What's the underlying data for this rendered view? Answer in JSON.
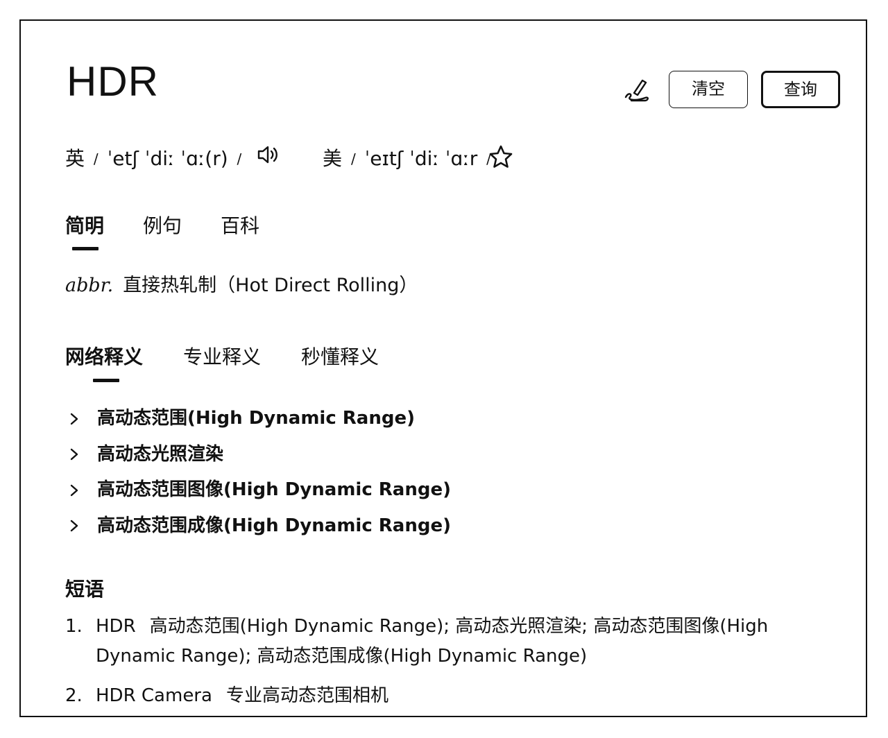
{
  "entry": {
    "word": "HDR"
  },
  "toolbar": {
    "handwrite_icon": "handwriting-pen-icon",
    "clear_label": "清空",
    "query_label": "查询"
  },
  "pronunciation": {
    "uk": {
      "label": "英",
      "ipa": "ˈetʃ ˈdiː ˈɑː(r)"
    },
    "us": {
      "label": "美",
      "ipa": "ˈeɪtʃ ˈdiː ˈɑːr"
    },
    "slash": "/",
    "speaker_icon": "speaker-icon",
    "favorite_icon": "star-icon"
  },
  "tabs_primary": {
    "items": [
      "简明",
      "例句",
      "百科"
    ],
    "active": 0
  },
  "brief": {
    "pos": "abbr.",
    "definition": "直接热轧制（Hot Direct Rolling）"
  },
  "tabs_secondary": {
    "items": [
      "网络释义",
      "专业释义",
      "秒懂释义"
    ],
    "active": 0
  },
  "web_definitions": [
    "高动态范围(High Dynamic Range)",
    "高动态光照渲染",
    "高动态范围图像(High Dynamic Range)",
    "高动态范围成像(High Dynamic Range)"
  ],
  "phrases": {
    "title": "短语",
    "items": [
      {
        "num": "1.",
        "en": "HDR",
        "zh": "高动态范围(High Dynamic Range); 高动态光照渲染; 高动态范围图像(High Dynamic Range); 高动态范围成像(High Dynamic Range)"
      },
      {
        "num": "2.",
        "en": "HDR Camera",
        "zh": "专业高动态范围相机"
      }
    ]
  }
}
